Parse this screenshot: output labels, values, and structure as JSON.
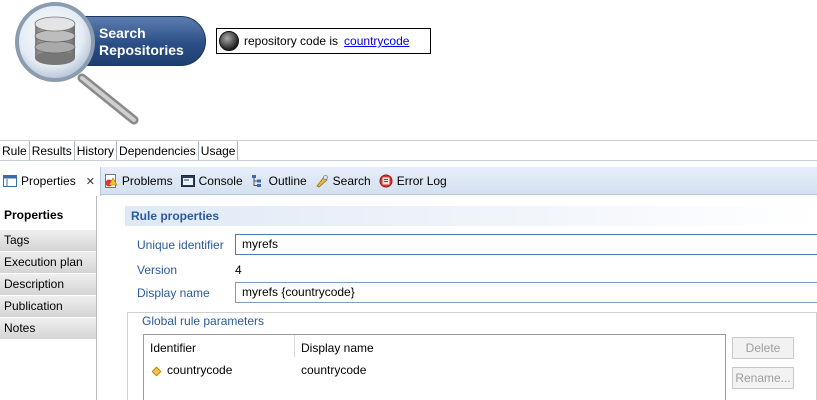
{
  "diagram": {
    "rule_title": "Search Repositories",
    "condition_text": "repository code is",
    "condition_link": "countrycode"
  },
  "editor_tabs": [
    "Rule",
    "Results",
    "History",
    "Dependencies",
    "Usage"
  ],
  "view_tabs": [
    {
      "label": "Properties",
      "icon": "properties-icon"
    },
    {
      "label": "Problems",
      "icon": "problems-icon"
    },
    {
      "label": "Console",
      "icon": "console-icon"
    },
    {
      "label": "Outline",
      "icon": "outline-icon"
    },
    {
      "label": "Search",
      "icon": "search-icon"
    },
    {
      "label": "Error Log",
      "icon": "error-log-icon"
    }
  ],
  "sidebar": {
    "items": [
      "Properties",
      "Tags",
      "Execution plan",
      "Description",
      "Publication",
      "Notes"
    ]
  },
  "rule_properties": {
    "header": "Rule properties",
    "unique_identifier_label": "Unique identifier",
    "unique_identifier_value": "myrefs",
    "version_label": "Version",
    "version_value": "4",
    "display_name_label": "Display name",
    "display_name_value": "myrefs {countrycode}"
  },
  "global_params": {
    "title": "Global rule parameters",
    "columns": [
      "Identifier",
      "Display name"
    ],
    "rows": [
      {
        "identifier": "countrycode",
        "display_name": "countrycode"
      }
    ],
    "delete_label": "Delete",
    "rename_label": "Rename..."
  },
  "colors": {
    "accent": "#2a5a9e",
    "pill": "#2a4f86",
    "link": "#0000ee"
  }
}
